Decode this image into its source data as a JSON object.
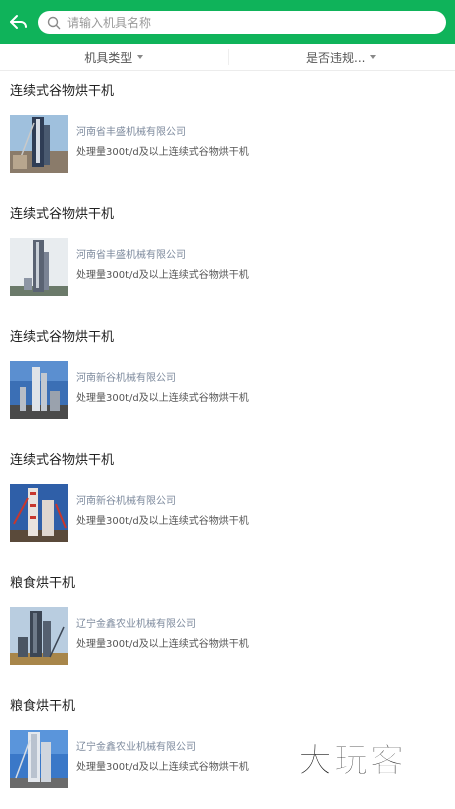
{
  "header": {
    "back_icon": "back-arrow-icon",
    "search": {
      "placeholder": "请输入机具名称",
      "value": "",
      "icon": "search-icon"
    }
  },
  "filters": [
    {
      "label": "机具类型",
      "icon": "caret-down-icon"
    },
    {
      "label": "是否违规...",
      "icon": "caret-down-icon"
    }
  ],
  "items": [
    {
      "title": "连续式谷物烘干机",
      "company": "河南省丰盛机械有限公司",
      "desc": "处理量300t/d及以上连续式谷物烘干机"
    },
    {
      "title": "连续式谷物烘干机",
      "company": "河南省丰盛机械有限公司",
      "desc": "处理量300t/d及以上连续式谷物烘干机"
    },
    {
      "title": "连续式谷物烘干机",
      "company": "河南新谷机械有限公司",
      "desc": "处理量300t/d及以上连续式谷物烘干机"
    },
    {
      "title": "连续式谷物烘干机",
      "company": "河南新谷机械有限公司",
      "desc": "处理量300t/d及以上连续式谷物烘干机"
    },
    {
      "title": "粮食烘干机",
      "company": "辽宁金鑫农业机械有限公司",
      "desc": "处理量300t/d及以上连续式谷物烘干机"
    },
    {
      "title": "粮食烘干机",
      "company": "辽宁金鑫农业机械有限公司",
      "desc": "处理量300t/d及以上连续式谷物烘干机"
    }
  ],
  "watermark": {
    "text": "大玩客"
  },
  "colors": {
    "header": "#0fb35a",
    "company_text": "#7d8a9d"
  }
}
